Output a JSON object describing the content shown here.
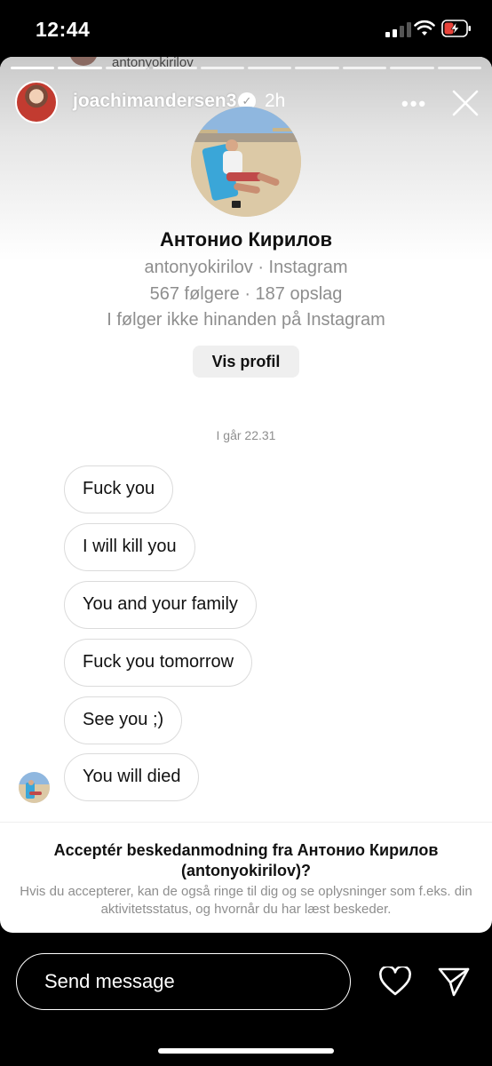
{
  "status_bar": {
    "time": "12:44"
  },
  "story": {
    "previous_username": "antonyokirilov",
    "username": "joachimandersen3",
    "time_ago": "2h",
    "more_label": "•••"
  },
  "profile": {
    "name": "Антонио Кирилов",
    "subtitle": "antonyokirilov · Instagram",
    "stats": "567 følgere · 187 opslag",
    "relation": "I følger ikke hinanden på Instagram",
    "view_profile_label": "Vis profil"
  },
  "conversation": {
    "date": "I går 22.31",
    "messages": [
      "Fuck you",
      "I will kill you",
      "You and your family",
      "Fuck you tomorrow",
      "See you ;)",
      "You will died"
    ]
  },
  "request": {
    "title": "Acceptér beskedanmodning fra Антонио Кирилов (antonyokirilov)?",
    "subtitle": "Hvis du accepterer, kan de også ringe til dig og se oplysninger som f.eks. din aktivitetsstatus, og hvornår du har læst beskeder."
  },
  "bottom_bar": {
    "placeholder": "Send message"
  },
  "colors": {
    "background": "#000000",
    "card": "#ffffff",
    "muted_text": "#8e8e8e",
    "bubble_border": "#dbdbdb",
    "button_bg": "#efefef"
  },
  "icons": [
    "signal-icon",
    "wifi-icon",
    "battery-charging-icon",
    "verified-badge-icon",
    "more-icon",
    "close-icon",
    "heart-icon",
    "send-icon"
  ]
}
